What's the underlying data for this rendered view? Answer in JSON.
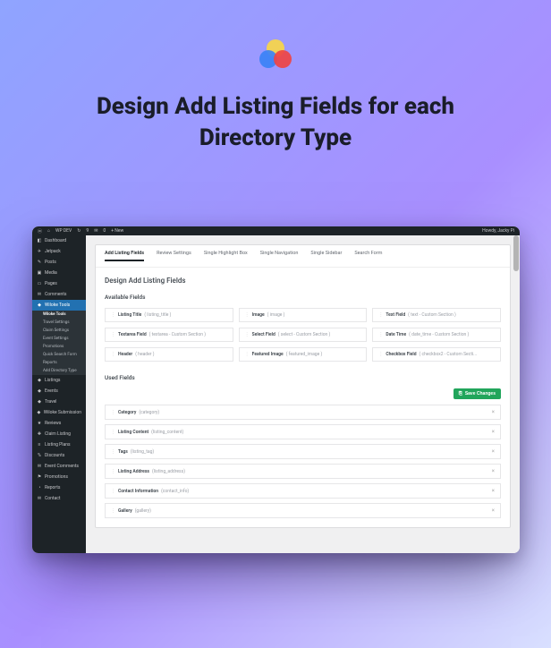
{
  "hero": {
    "title": "Design Add Listing Fields for each Directory Type"
  },
  "adminbar": {
    "site": "WP DEV",
    "comments": "0",
    "updates": "9",
    "new": "New",
    "howdy": "Howdy, Jacky Pi"
  },
  "sidebar": {
    "items": [
      {
        "icon": "◧",
        "label": "Dashboard"
      },
      {
        "icon": "✈",
        "label": "Jetpack"
      },
      {
        "icon": "✎",
        "label": "Posts"
      },
      {
        "icon": "▣",
        "label": "Media"
      },
      {
        "icon": "▭",
        "label": "Pages"
      },
      {
        "icon": "✉",
        "label": "Comments"
      },
      {
        "icon": "◆",
        "label": "Wiloke Tools",
        "active": true
      }
    ],
    "sub": [
      "Wiloke Tools",
      "Travel Settings",
      "Claim Settings",
      "Event Settings",
      "Promotions",
      "Quick Search Form",
      "Reports",
      "Add Directory Type"
    ],
    "items2": [
      {
        "icon": "◆",
        "label": "Listings"
      },
      {
        "icon": "◆",
        "label": "Events"
      },
      {
        "icon": "◆",
        "label": "Travel"
      },
      {
        "icon": "◆",
        "label": "Wiloke Submission"
      },
      {
        "icon": "★",
        "label": "Reviews"
      },
      {
        "icon": "✚",
        "label": "Claim Listing"
      },
      {
        "icon": "≡",
        "label": "Listing Plans"
      },
      {
        "icon": "%",
        "label": "Discounts"
      },
      {
        "icon": "✉",
        "label": "Event Comments"
      },
      {
        "icon": "⚑",
        "label": "Promotions"
      },
      {
        "icon": "◔",
        "label": "Reports"
      },
      {
        "icon": "✉",
        "label": "Contact"
      }
    ]
  },
  "tabs": [
    "Add Listing Fields",
    "Review Settings",
    "Single Highlight Box",
    "Single Navigation",
    "Single Sidebar",
    "Search Form"
  ],
  "page": {
    "title": "Design Add Listing Fields",
    "available_heading": "Available Fields",
    "used_heading": "Used Fields",
    "save": "Save Changes"
  },
  "available": [
    {
      "name": "Listing Title",
      "slug": "( listing_title )"
    },
    {
      "name": "Image",
      "slug": "( image )"
    },
    {
      "name": "Text Field",
      "slug": "( text - Custom Section )"
    },
    {
      "name": "Textarea Field",
      "slug": "( textarea - Custom Section )"
    },
    {
      "name": "Select Field",
      "slug": "( select - Custom Section )"
    },
    {
      "name": "Date Time",
      "slug": "( date_time - Custom Section )"
    },
    {
      "name": "Header",
      "slug": "( header )"
    },
    {
      "name": "Featured Image",
      "slug": "( featured_image )"
    },
    {
      "name": "Checkbox Field",
      "slug": "( checkbox2 - Custom Secti..."
    }
  ],
  "used": [
    {
      "name": "Category",
      "slug": "(category)"
    },
    {
      "name": "Listing Content",
      "slug": "(listing_content)"
    },
    {
      "name": "Tags",
      "slug": "(listing_tag)"
    },
    {
      "name": "Listing Address",
      "slug": "(listing_address)"
    },
    {
      "name": "Contact Information",
      "slug": "(contact_info)"
    },
    {
      "name": "Gallery",
      "slug": "(gallery)"
    }
  ]
}
